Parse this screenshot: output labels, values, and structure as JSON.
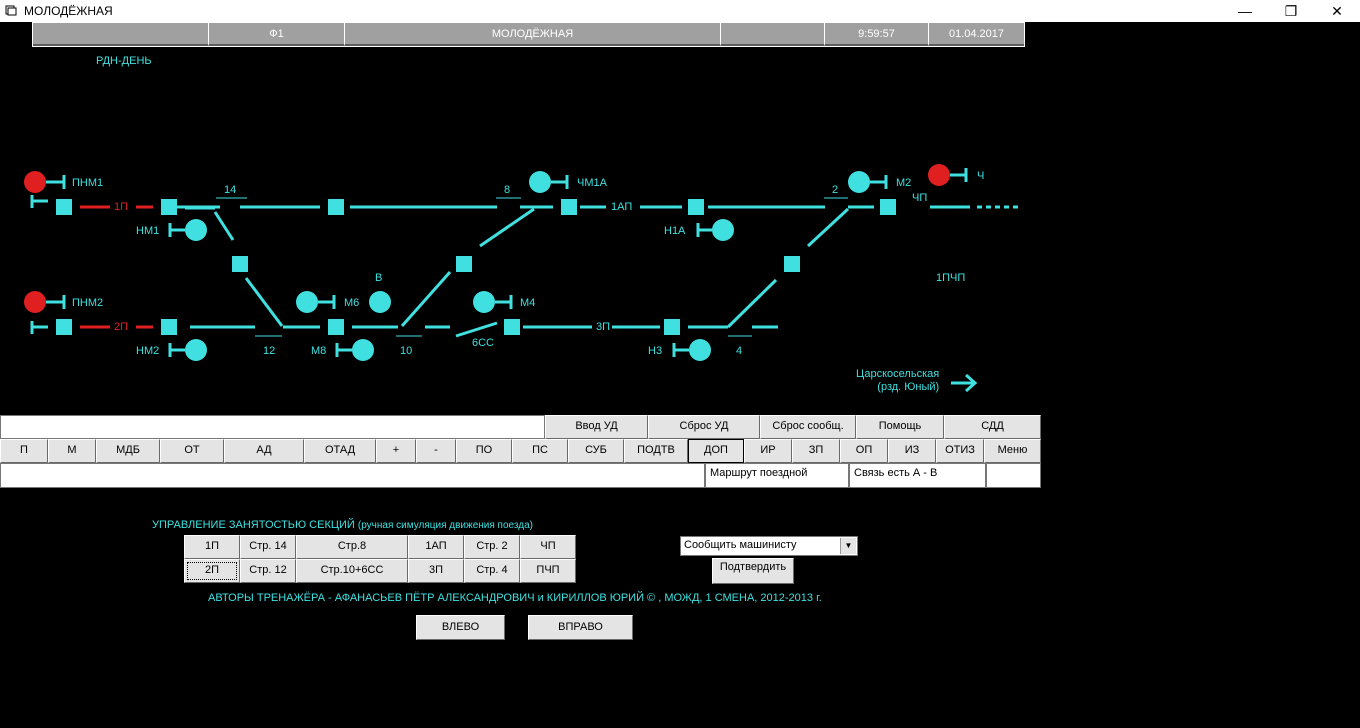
{
  "window": {
    "title": "МОЛОДЁЖНАЯ",
    "min": "—",
    "max": "❐",
    "close": "✕"
  },
  "header": {
    "cells": [
      "",
      "Ф1",
      "МОЛОДЁЖНАЯ",
      "",
      "9:59:57",
      "01.04.2017"
    ]
  },
  "mode_label": "РДН-ДЕНЬ",
  "scheme": {
    "signals": {
      "pnm1": "ПНМ1",
      "pnm2": "ПНМ2",
      "nm1": "НМ1",
      "nm2": "НМ2",
      "m6": "М6",
      "m8": "М8",
      "v": "В",
      "m4": "М4",
      "chm1a": "ЧМ1А",
      "n1a": "Н1А",
      "n3": "Н3",
      "m2": "М2",
      "ch": "Ч"
    },
    "tracks": {
      "t1p": "1П",
      "t2p": "2П",
      "t1ap": "1АП",
      "t3p": "3П",
      "tchp": "ЧП",
      "t1pchp": "1ПЧП"
    },
    "switches": {
      "s14": "14",
      "s12": "12",
      "s10": "10",
      "s6cc": "6СС",
      "s8": "8",
      "s4": "4",
      "s2": "2"
    },
    "station_next": {
      "line1": "Царскосельская",
      "line2": "(рзд. Юный)"
    }
  },
  "controls": {
    "row1": [
      "Ввод УД",
      "Сброс УД",
      "Сброс сообщ.",
      "Помощь",
      "СДД"
    ],
    "row2": [
      "П",
      "М",
      "МДБ",
      "ОТ",
      "АД",
      "ОТАД",
      "+",
      "-",
      "ПО",
      "ПС",
      "СУБ",
      "ПОДТВ",
      "ДОП",
      "ИР",
      "ЗП",
      "ОП",
      "ИЗ",
      "ОТИЗ",
      "Меню"
    ],
    "status": {
      "route": "Маршрут поездной",
      "link": "Связь есть А - В"
    }
  },
  "occupancy": {
    "title": "УПРАВЛЕНИЕ ЗАНЯТОСТЬЮ СЕКЦИЙ",
    "subtitle": "(ручная симуляция движения поезда)",
    "row1": [
      "1П",
      "Стр. 14",
      "Стр.8",
      "1АП",
      "Стр. 2",
      "ЧП"
    ],
    "row2": [
      "2П",
      "Стр. 12",
      "Стр.10+6СС",
      "3П",
      "Стр. 4",
      "ПЧП"
    ]
  },
  "message": {
    "select": "Сообщить машинисту",
    "confirm": "Подтвердить"
  },
  "authors": "АВТОРЫ ТРЕНАЖЁРА - АФАНАСЬЕВ ПЁТР АЛЕКСАНДРОВИЧ и КИРИЛЛОВ ЮРИЙ © , МОЖД, 1 СМЕНА, 2012-2013 г.",
  "nav": {
    "left": "ВЛЕВО",
    "right": "ВПРАВО"
  },
  "colors": {
    "track": "#40e0e0",
    "occupied": "#e02020",
    "background": "#000000"
  }
}
